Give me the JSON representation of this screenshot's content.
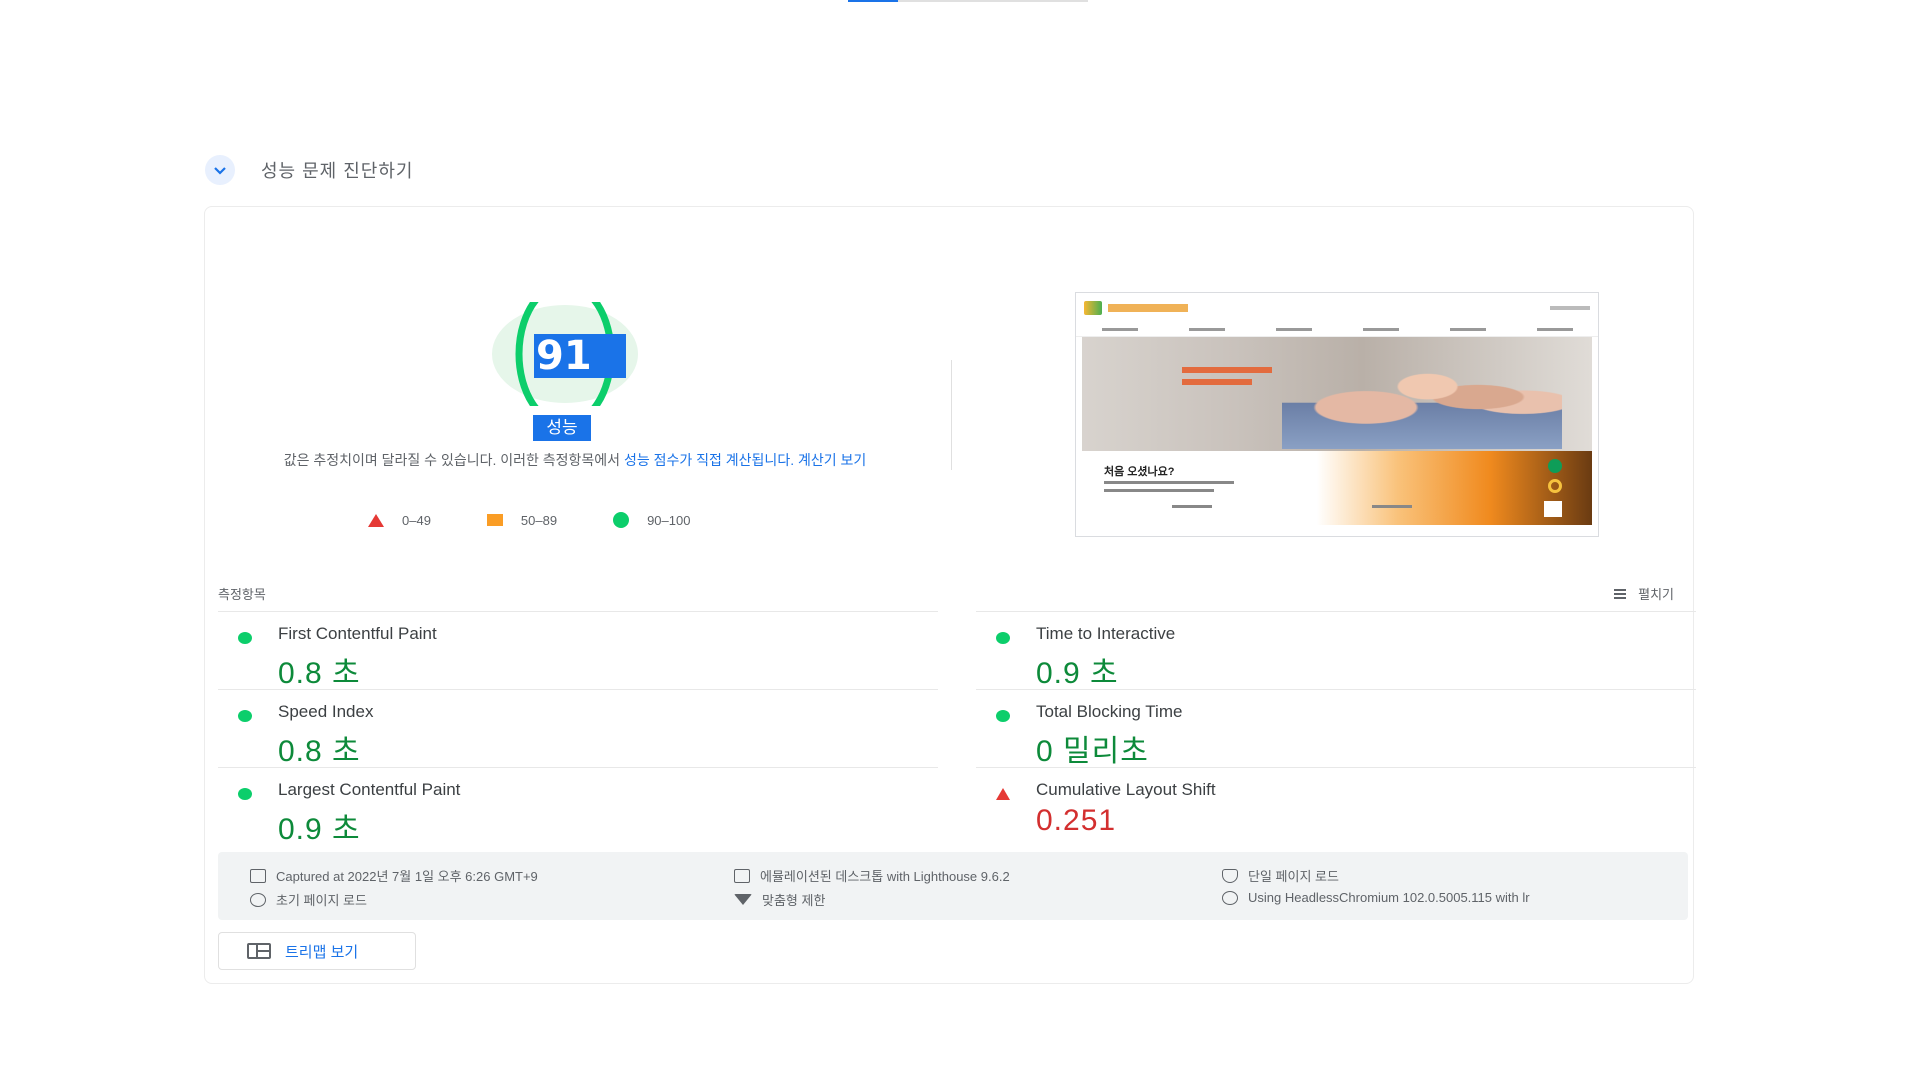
{
  "diagnose": {
    "title": "성능 문제 진단하기"
  },
  "gauge": {
    "score": "91",
    "score_fraction": 0.91,
    "label": "성능",
    "description_plain": "값은 추정치이며 달라질 수 있습니다. 이러한 측정항목에서 ",
    "description_link": "성능 점수가 직접 계산됩니다.",
    "calculator_link": "계산기 보기",
    "ring_color": "#0cce6b"
  },
  "legend": [
    {
      "range": "0–49",
      "shape": "triangle",
      "color": "#e53935"
    },
    {
      "range": "50–89",
      "shape": "square",
      "color": "#fa9d25"
    },
    {
      "range": "90–100",
      "shape": "circle",
      "color": "#0cce6b"
    }
  ],
  "thumbnail": {
    "question": "처음 오셨나요?"
  },
  "metrics": {
    "section_label": "측정항목",
    "expand_label": "펼치기",
    "left": [
      {
        "title": "First Contentful Paint",
        "value": "0.8 초",
        "status": "good"
      },
      {
        "title": "Speed Index",
        "value": "0.8 초",
        "status": "good"
      },
      {
        "title": "Largest Contentful Paint",
        "value": "0.9 초",
        "status": "good"
      }
    ],
    "right": [
      {
        "title": "Time to Interactive",
        "value": "0.9 초",
        "status": "good"
      },
      {
        "title": "Total Blocking Time",
        "value": "0 밀리초",
        "status": "good"
      },
      {
        "title": "Cumulative Layout Shift",
        "value": "0.251",
        "status": "bad"
      }
    ]
  },
  "info": {
    "captured": "Captured at 2022년 7월 1일 오후 6:26 GMT+9",
    "initial_load": "초기 페이지 로드",
    "emulated": "에뮬레이션된 데스크톱 with Lighthouse 9.6.2",
    "throttling": "맞춤형 제한",
    "single_page": "단일 페이지 로드",
    "using": "Using HeadlessChromium 102.0.5005.115 with lr"
  },
  "treemap": {
    "label": "트리맵 보기"
  }
}
